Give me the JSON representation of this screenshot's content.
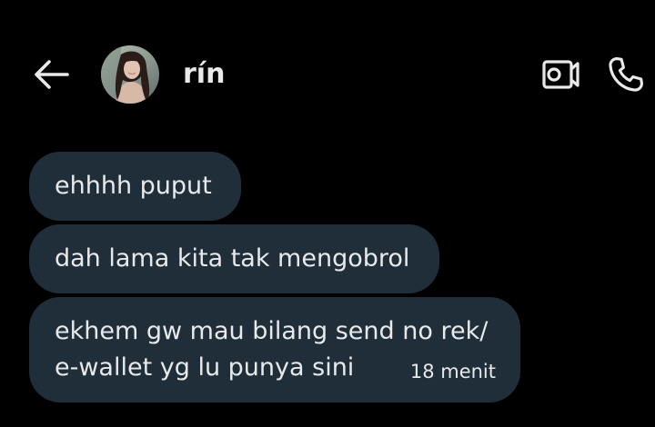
{
  "header": {
    "contact_name": "rín",
    "avatar_alt": "rín"
  },
  "icons": {
    "back": "arrow-left-icon",
    "video": "video-camera-icon",
    "call": "phone-icon"
  },
  "messages": [
    {
      "text": "ehhhh puput"
    },
    {
      "text": "dah lama kita tak mengobrol"
    },
    {
      "line1": "ekhem gw mau bilang send no rek/",
      "line2": "e-wallet yg lu punya sini",
      "time": "18 menit"
    }
  ],
  "colors": {
    "background": "#000000",
    "bubble": "#202e3a",
    "text": "#e7e9ea"
  }
}
